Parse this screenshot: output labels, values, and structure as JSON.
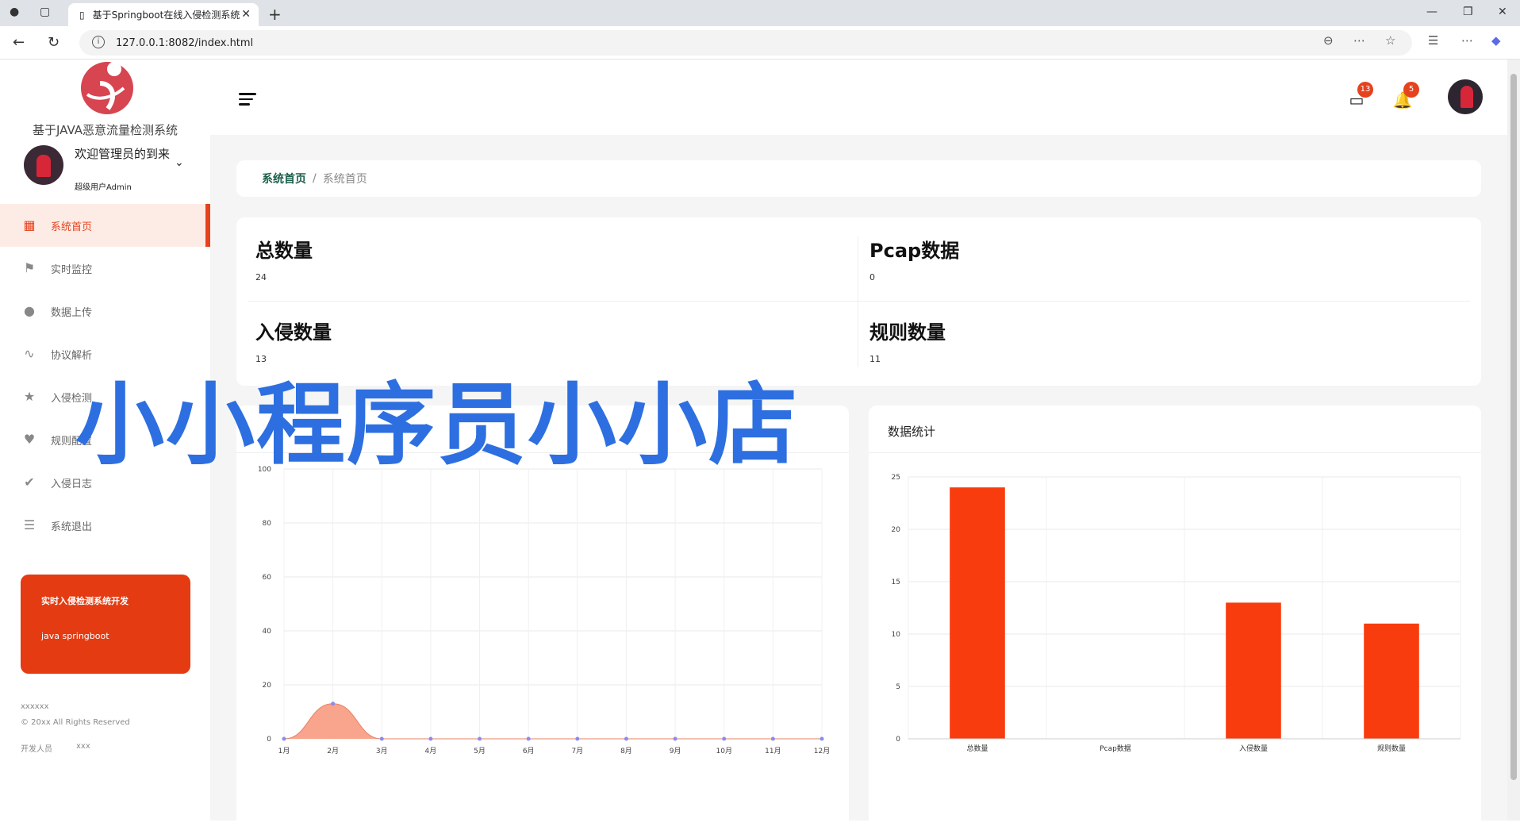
{
  "browser": {
    "tab_title": "基于Springboot在线入侵检测系统",
    "url": "127.0.0.1:8082/index.html"
  },
  "sidebar": {
    "app_title": "基于JAVA恶意流量检测系统",
    "user_name": "欢迎管理员的到来",
    "user_role": "超级用户Admin",
    "items": [
      {
        "label": "系统首页",
        "icon": "dashboard-icon",
        "active": true
      },
      {
        "label": "实时监控",
        "icon": "flag-icon"
      },
      {
        "label": "数据上传",
        "icon": "info-icon"
      },
      {
        "label": "协议解析",
        "icon": "activity-icon"
      },
      {
        "label": "入侵检测",
        "icon": "star-icon"
      },
      {
        "label": "规则配置",
        "icon": "heart-icon"
      },
      {
        "label": "入侵日志",
        "icon": "thumbs-icon"
      },
      {
        "label": "系统退出",
        "icon": "list-icon"
      }
    ],
    "promo_title": "实时入侵检测系统开发",
    "promo_sub": "java springboot",
    "foot1": "xxxxxx",
    "foot2": "© 20xx All Rights Reserved",
    "foot3": "开发人员",
    "foot4": "xxx"
  },
  "header": {
    "messages_badge": "13",
    "notifications_badge": "5"
  },
  "breadcrumb": {
    "home": "系统首页",
    "sep": "/",
    "current": "系统首页"
  },
  "stats": [
    {
      "label": "总数量",
      "value": "24"
    },
    {
      "label": "Pcap数据",
      "value": "0"
    },
    {
      "label": "入侵数量",
      "value": "13"
    },
    {
      "label": "规则数量",
      "value": "11"
    }
  ],
  "watermark": "小小程序员小小店",
  "colors": {
    "accent": "#e6421d",
    "bar": "#f83c0e",
    "area": "#f89a80"
  },
  "chart_data": [
    {
      "type": "area",
      "title": "",
      "x": [
        "1月",
        "2月",
        "3月",
        "4月",
        "5月",
        "6月",
        "7月",
        "8月",
        "9月",
        "10月",
        "11月",
        "12月"
      ],
      "values": [
        0,
        13,
        0,
        0,
        0,
        0,
        0,
        0,
        0,
        0,
        0,
        0
      ],
      "ylim": [
        0,
        100
      ],
      "yticks": [
        0,
        20,
        40,
        60,
        80,
        100
      ],
      "grid": true
    },
    {
      "type": "bar",
      "title": "数据统计",
      "categories": [
        "总数量",
        "Pcap数据",
        "入侵数量",
        "规则数量"
      ],
      "values": [
        24,
        0,
        13,
        11
      ],
      "ylim": [
        0,
        25
      ],
      "yticks": [
        0,
        5,
        10,
        15,
        20,
        25
      ],
      "grid": true
    }
  ]
}
